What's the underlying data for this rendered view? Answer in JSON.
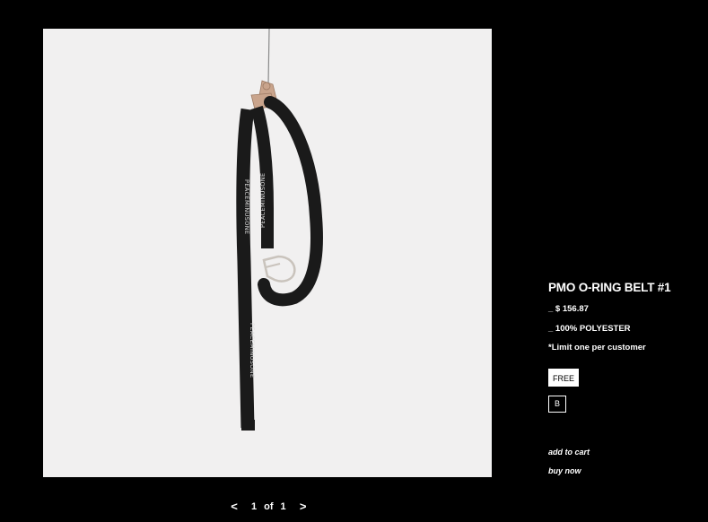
{
  "product": {
    "title": "PMO O-RING BELT #1",
    "price": "_ $ 156.87",
    "material": "_ 100% POLYESTER",
    "limit_note": "*Limit one per customer",
    "belt_print_text": "PEACEMINUSONE"
  },
  "options": {
    "size": "FREE",
    "color": "B"
  },
  "actions": {
    "add_to_cart": "add to cart",
    "buy_now": "buy now"
  },
  "pager": {
    "prev": "<",
    "current": "1",
    "of": "of",
    "total": "1",
    "next": ">"
  },
  "colors": {
    "background": "#000000",
    "image_background": "#f1f0f0",
    "belt": "#1a1a1a",
    "ring": "#c9c3bc",
    "clip": "#c9a48c",
    "text": "#ffffff"
  }
}
